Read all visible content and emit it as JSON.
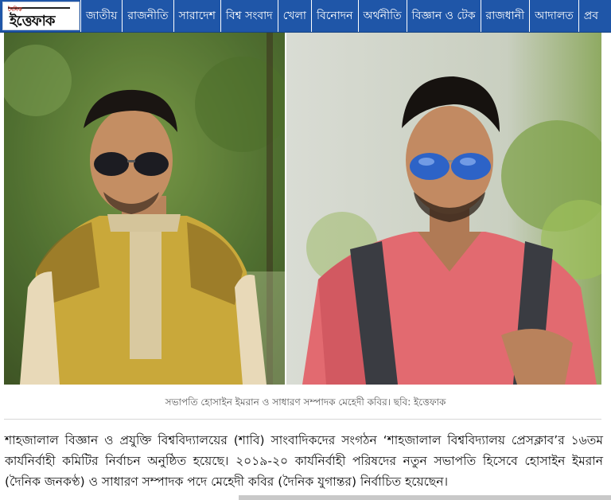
{
  "header": {
    "logo": {
      "small_text": "দৈনিক",
      "main_text": "ইত্তেফাক"
    },
    "nav": [
      "জাতীয়",
      "রাজনীতি",
      "সারাদেশ",
      "বিশ্ব সংবাদ",
      "খেলা",
      "বিনোদন",
      "অর্থনীতি",
      "বিজ্ঞান ও টেক",
      "রাজধানী",
      "আদালত",
      "প্রব"
    ],
    "colors": {
      "nav_bg": "#1f56a8",
      "nav_text": "#ffffff"
    }
  },
  "photos": {
    "left": {
      "subject": "man in yellow panjabi with sunglasses"
    },
    "right": {
      "subject": "man in pink shirt with blue mirrored sunglasses"
    },
    "caption": "সভাপতি হোসাইন ইমরান ও সাধারণ সম্পাদক মেহেদী কবির। ছবি: ইত্তেফাক"
  },
  "article": {
    "paragraph": "শাহজালাল বিজ্ঞান ও প্রযুক্তি বিশ্ববিদ্যালয়ের (শাবি) সাংবাদিকদের সংগঠন ‘শাহজালাল বিশ্ববিদ্যালয় প্রেসক্লাব’র ১৬তম কার্যনির্বাহী কমিটির নির্বাচন অনুষ্ঠিত হয়েছে। ২০১৯-২০ কার্যনির্বাহী পরিষদের নতুন সভাপতি হিসেবে হোসাইন ইমরান (দৈনিক জনকণ্ঠ) ও সাধারণ সম্পাদক পদে মেহেদী কবির (দৈনিক যুগান্তর) নির্বাচিত হয়েছেন।"
  }
}
